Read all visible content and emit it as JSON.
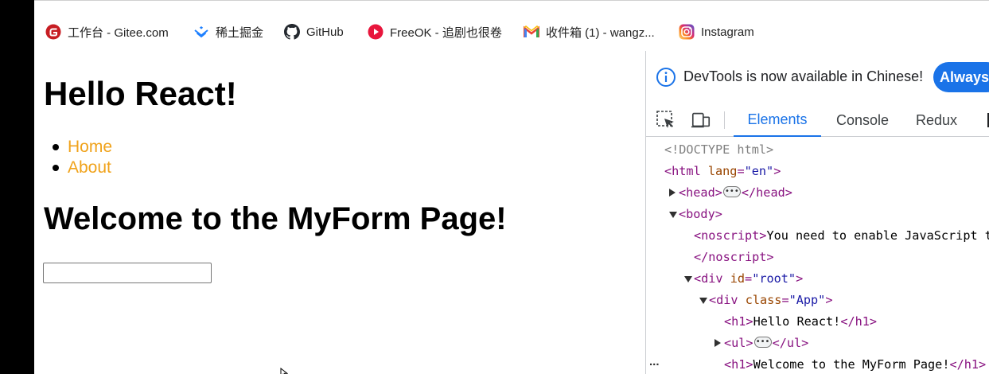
{
  "bookmarks": [
    {
      "label": "工作台 - Gitee.com",
      "icon": "gitee-icon"
    },
    {
      "label": "稀土掘金",
      "icon": "juejin-icon"
    },
    {
      "label": "GitHub",
      "icon": "github-icon"
    },
    {
      "label": "FreeOK - 追剧也很卷",
      "icon": "freeok-icon"
    },
    {
      "label": "收件箱 (1) - wangz...",
      "icon": "gmail-icon"
    },
    {
      "label": "Instagram",
      "icon": "instagram-icon"
    }
  ],
  "page": {
    "title": "Hello React!",
    "nav": [
      "Home",
      "About"
    ],
    "heading": "Welcome to the MyForm Page!",
    "input_value": ""
  },
  "devtools": {
    "banner_text": "DevTools is now available in Chinese!",
    "banner_button": "Always",
    "tabs": [
      "Elements",
      "Console",
      "Redux"
    ],
    "active_tab": "Elements",
    "more_label": "..."
  },
  "dom": {
    "doctype": "<!DOCTYPE html>",
    "html_open": "<html",
    "lang_attr": "lang",
    "lang_val": "\"en\"",
    "head_open": "<head>",
    "head_close": "</head>",
    "body_open": "<body>",
    "noscript_open": "<noscript>",
    "noscript_text": "You need to enable JavaScript to run this app.",
    "noscript_close": "</noscript>",
    "div_open": "<div",
    "id_attr": "id",
    "id_val": "\"root\"",
    "class_attr": "class",
    "class_val": "\"App\"",
    "h1_open": "<h1>",
    "h1_text": "Hello React!",
    "h1_close": "</h1>",
    "ul_open": "<ul>",
    "ul_close": "</ul>",
    "h1_text_2": "Welcome to the MyForm Page!",
    "h1_close_2": "</h1>"
  },
  "colors": {
    "link": "#f0a21a",
    "accent": "#1a73e8",
    "tag": "#881280",
    "attr_name": "#994500",
    "attr_value": "#1a1aa6"
  }
}
